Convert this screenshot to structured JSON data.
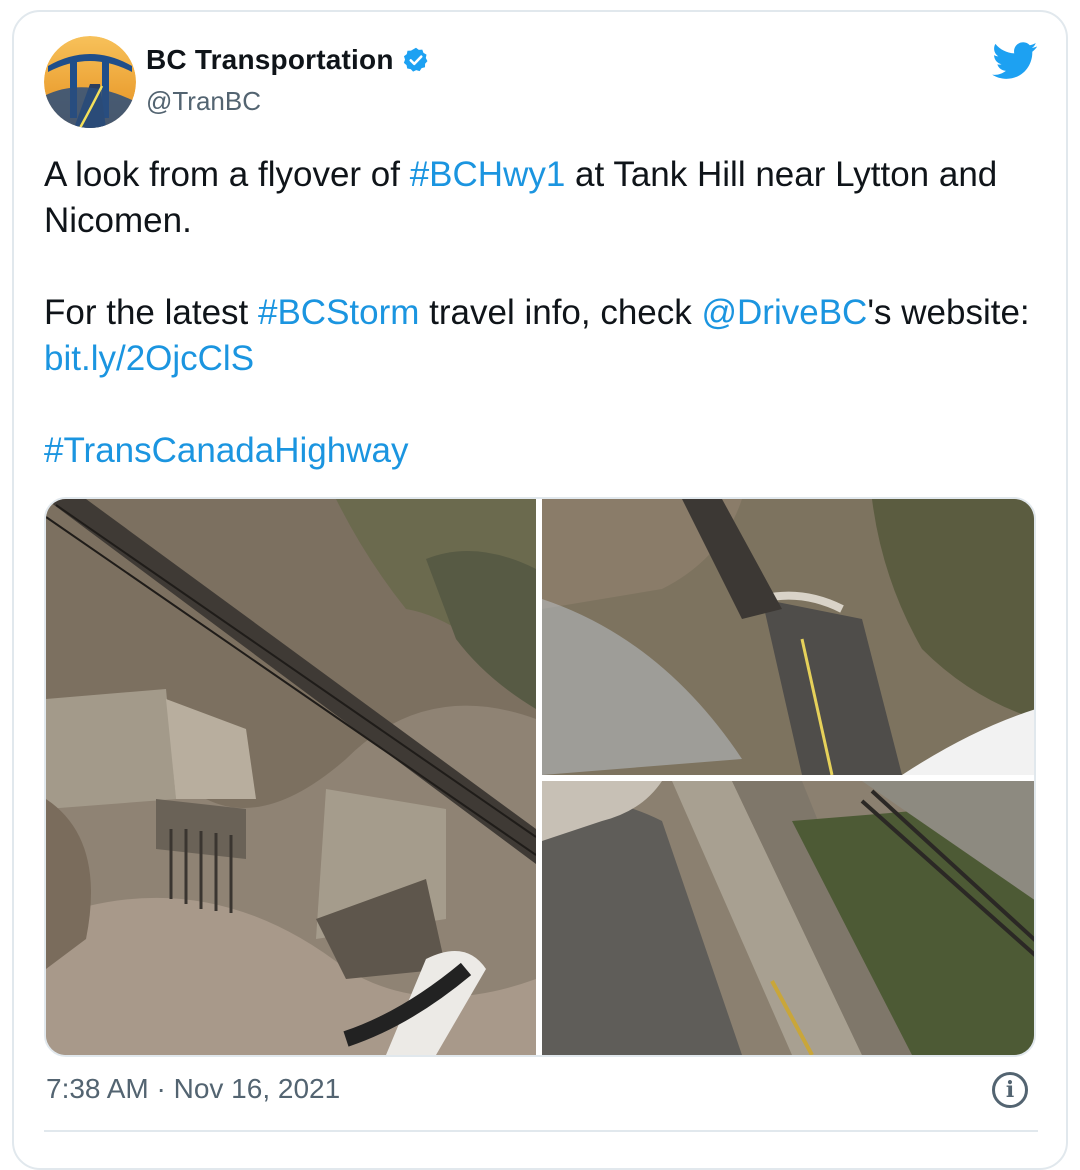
{
  "account": {
    "display_name": "BC Transportation",
    "handle": "@TranBC",
    "verified": true,
    "avatar_icon": "bc-transportation-logo-icon",
    "platform_icon": "twitter-bird-icon"
  },
  "tweet": {
    "line1": {
      "t1": "A look from a flyover of ",
      "hashtag": "#BCHwy1",
      "t2": " at Tank Hill near Lytton and Nicomen."
    },
    "line2": {
      "t1": "For the latest ",
      "hashtag": "#BCStorm",
      "t2": " travel info, check ",
      "mention": "@DriveBC",
      "t3": "'s website: ",
      "url": "bit.ly/2OjcClS"
    },
    "line3": {
      "hashtag": "#TransCanadaHighway"
    }
  },
  "media": {
    "photo_count": 3,
    "photos": [
      "railway-bridge-over-washout-photo",
      "collapsed-highway-aerial-photo",
      "flood-debris-highway-photo"
    ]
  },
  "footer": {
    "timestamp": "7:38 AM · Nov 16, 2021",
    "info_icon": "info-icon"
  },
  "colors": {
    "link": "#1b95e0",
    "twitter_blue": "#1da1f2",
    "text": "#0f1419",
    "muted": "#536471",
    "border": "#e1e8ed"
  }
}
